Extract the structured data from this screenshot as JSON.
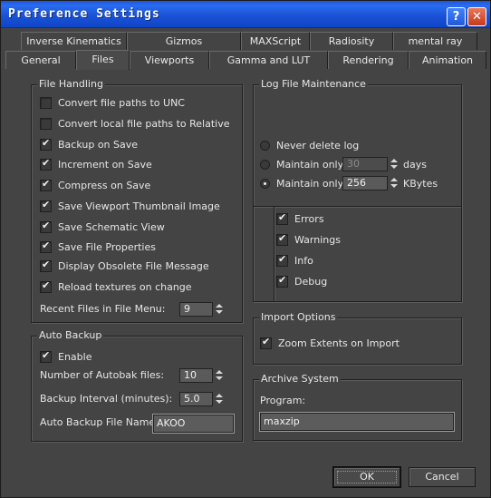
{
  "window": {
    "title": "Preference Settings",
    "help_glyph": "?",
    "close_glyph": "✕",
    "colors": {
      "titlebar": "#1b53d6",
      "panel": "#444444",
      "close_button": "#c5391b"
    }
  },
  "tabs": {
    "row1": [
      "Inverse Kinematics",
      "Gizmos",
      "MAXScript",
      "Radiosity",
      "mental ray"
    ],
    "row2": [
      "General",
      "Files",
      "Viewports",
      "Gamma and LUT",
      "Rendering",
      "Animation"
    ],
    "active": "Files"
  },
  "file_handling": {
    "title": "File Handling",
    "options": [
      {
        "label": "Convert file paths to UNC",
        "checked": false
      },
      {
        "label": "Convert local file paths to Relative",
        "checked": false
      },
      {
        "label": "Backup on Save",
        "checked": true
      },
      {
        "label": "Increment on Save",
        "checked": true
      },
      {
        "label": "Compress on Save",
        "checked": true
      },
      {
        "label": "Save Viewport Thumbnail Image",
        "checked": true
      },
      {
        "label": "Save Schematic View",
        "checked": true
      },
      {
        "label": "Save File Properties",
        "checked": true
      },
      {
        "label": "Display Obsolete File Message",
        "checked": true
      },
      {
        "label": "Reload textures on change",
        "checked": true
      }
    ],
    "recent_files_label": "Recent Files in File Menu:",
    "recent_files_value": "9"
  },
  "auto_backup": {
    "title": "Auto Backup",
    "enable_label": "Enable",
    "enable_checked": true,
    "num_files_label": "Number of Autobak files:",
    "num_files_value": "10",
    "interval_label": "Backup Interval (minutes):",
    "interval_value": "5.0",
    "file_name_label": "Auto Backup File Name:",
    "file_name_value": "AKOO"
  },
  "log_file": {
    "title": "Log File Maintenance",
    "never_label": "Never delete log",
    "maintain_days_label": "Maintain only",
    "maintain_days_value": "30",
    "days_unit": "days",
    "maintain_kb_label": "Maintain only",
    "maintain_kb_value": "256",
    "kb_unit": "KBytes",
    "selected": "kbytes",
    "levels": [
      {
        "label": "Errors",
        "checked": true
      },
      {
        "label": "Warnings",
        "checked": true
      },
      {
        "label": "Info",
        "checked": true
      },
      {
        "label": "Debug",
        "checked": true
      }
    ]
  },
  "import_options": {
    "title": "Import Options",
    "zoom_label": "Zoom Extents on Import",
    "zoom_checked": true
  },
  "archive": {
    "title": "Archive System",
    "program_label": "Program:",
    "program_value": "maxzip"
  },
  "buttons": {
    "ok": "OK",
    "cancel": "Cancel"
  }
}
